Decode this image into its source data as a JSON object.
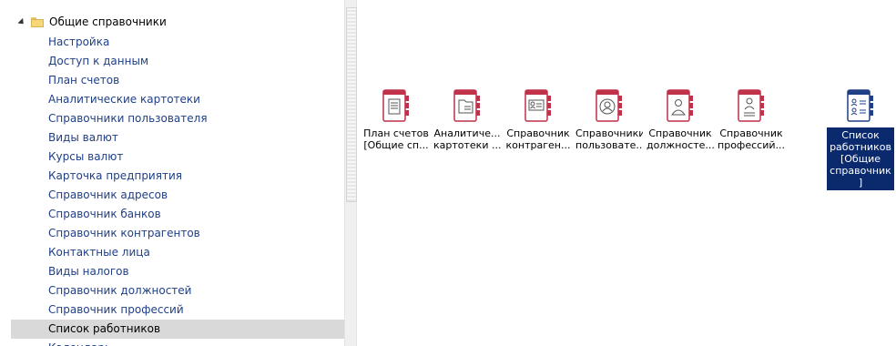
{
  "tree": {
    "partial_top_text": "’  ‘ ’",
    "parent": {
      "label": "Общие справочники"
    },
    "items": [
      {
        "label": "Настройка"
      },
      {
        "label": "Доступ к данным"
      },
      {
        "label": "План счетов"
      },
      {
        "label": "Аналитические картотеки"
      },
      {
        "label": "Справочники пользователя"
      },
      {
        "label": "Виды валют"
      },
      {
        "label": "Курсы валют"
      },
      {
        "label": "Карточка предприятия"
      },
      {
        "label": "Справочник адресов"
      },
      {
        "label": "Справочник банков"
      },
      {
        "label": "Справочник контрагентов"
      },
      {
        "label": "Контактные лица"
      },
      {
        "label": "Виды налогов"
      },
      {
        "label": "Справочник должностей"
      },
      {
        "label": "Справочник профессий"
      },
      {
        "label": "Список работников",
        "selected": true
      },
      {
        "label": "Календарь"
      }
    ]
  },
  "tiles": [
    {
      "line1": "План счетов",
      "line2": "[Общие сп...",
      "icon": "ledger-icon"
    },
    {
      "line1": "Аналитиче...",
      "line2": "картотеки ...",
      "icon": "folder-doc-icon"
    },
    {
      "line1": "Справочник",
      "line2": "контраген...",
      "icon": "contact-card-icon"
    },
    {
      "line1": "Справочники",
      "line2": "пользовате...",
      "icon": "user-circle-icon"
    },
    {
      "line1": "Справочник",
      "line2": "должносте...",
      "icon": "person-badge-icon"
    },
    {
      "line1": "Справочник",
      "line2": "профессий...",
      "icon": "person-tools-icon"
    },
    {
      "line1": "Список",
      "line2": "работников",
      "line3": "[Общие",
      "line4": "справочник",
      "line5": "]",
      "icon": "people-list-icon",
      "selected": true
    }
  ],
  "colors": {
    "accent": "#c0314a",
    "selected_bg": "#0b2a6d",
    "tree_text": "#1f3f86",
    "tree_selected": "#d9d9d9",
    "folder": "#f5d779",
    "list_icon": "#1f3f86"
  }
}
